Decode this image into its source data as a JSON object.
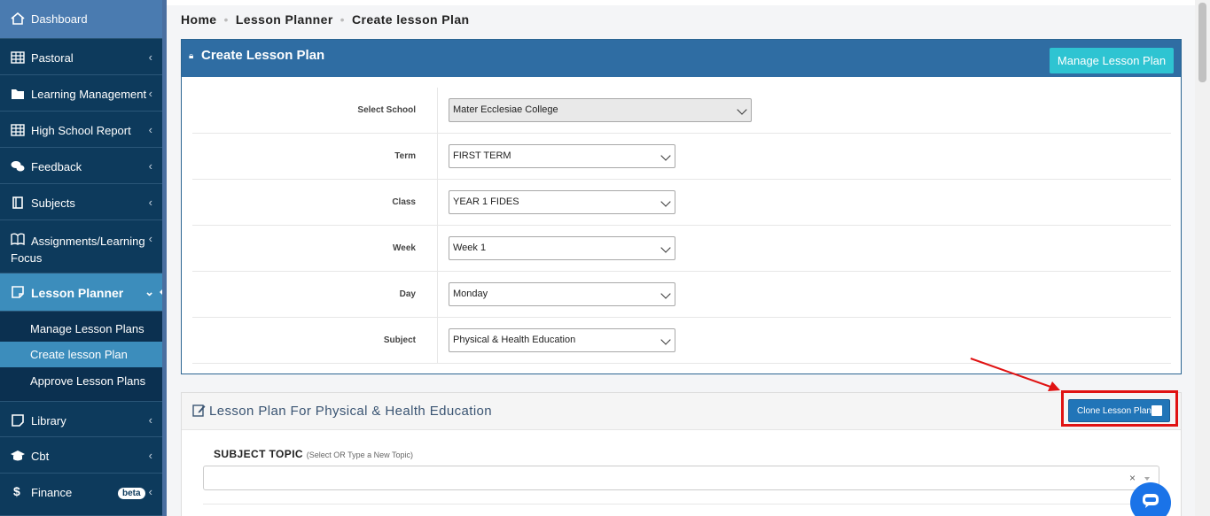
{
  "sidebar": {
    "items": [
      {
        "label": "Dashboard",
        "icon": "home-icon"
      },
      {
        "label": "Pastoral",
        "icon": "table-icon"
      },
      {
        "label": "Learning Management",
        "icon": "folder-icon"
      },
      {
        "label": "High School Report",
        "icon": "table-icon"
      },
      {
        "label": "Feedback",
        "icon": "comments-icon"
      },
      {
        "label": "Subjects",
        "icon": "book-icon"
      },
      {
        "label": "Assignments/Learning Focus",
        "icon": "open-book-icon"
      },
      {
        "label": "Lesson Planner",
        "icon": "note-icon"
      },
      {
        "label": "Library",
        "icon": "book-icon"
      },
      {
        "label": "Cbt",
        "icon": "graduation-cap-icon"
      },
      {
        "label": "Finance",
        "icon": "dollar-icon",
        "badge": "beta"
      }
    ],
    "subitems": [
      {
        "label": "Manage Lesson Plans"
      },
      {
        "label": "Create lesson Plan"
      },
      {
        "label": "Approve Lesson Plans"
      }
    ]
  },
  "breadcrumb": [
    "Home",
    "Lesson Planner",
    "Create lesson Plan"
  ],
  "panel1": {
    "title": "Create Lesson Plan",
    "manage_button": "Manage Lesson Plan",
    "fields": [
      {
        "label": "Select School",
        "value": "Mater Ecclesiae College"
      },
      {
        "label": "Term",
        "value": "FIRST TERM"
      },
      {
        "label": "Class",
        "value": "YEAR 1 FIDES"
      },
      {
        "label": "Week",
        "value": "Week 1"
      },
      {
        "label": "Day",
        "value": "Monday"
      },
      {
        "label": "Subject",
        "value": "Physical & Health Education"
      }
    ]
  },
  "panel2": {
    "title": "Lesson Plan For Physical & Health Education",
    "clone_button": "Clone Lesson Plan",
    "topic_label": "SUBJECT TOPIC",
    "topic_hint": "(Select OR Type a New Topic)",
    "topic_clear": "×"
  },
  "colors": {
    "sidebar_bg": "#0d3a5c",
    "active_bg": "#3c8dbc",
    "panel_header": "#2f6da3",
    "manage_button": "#2ec4d2",
    "clone_button": "#2175b8",
    "highlight": "#e01313"
  }
}
